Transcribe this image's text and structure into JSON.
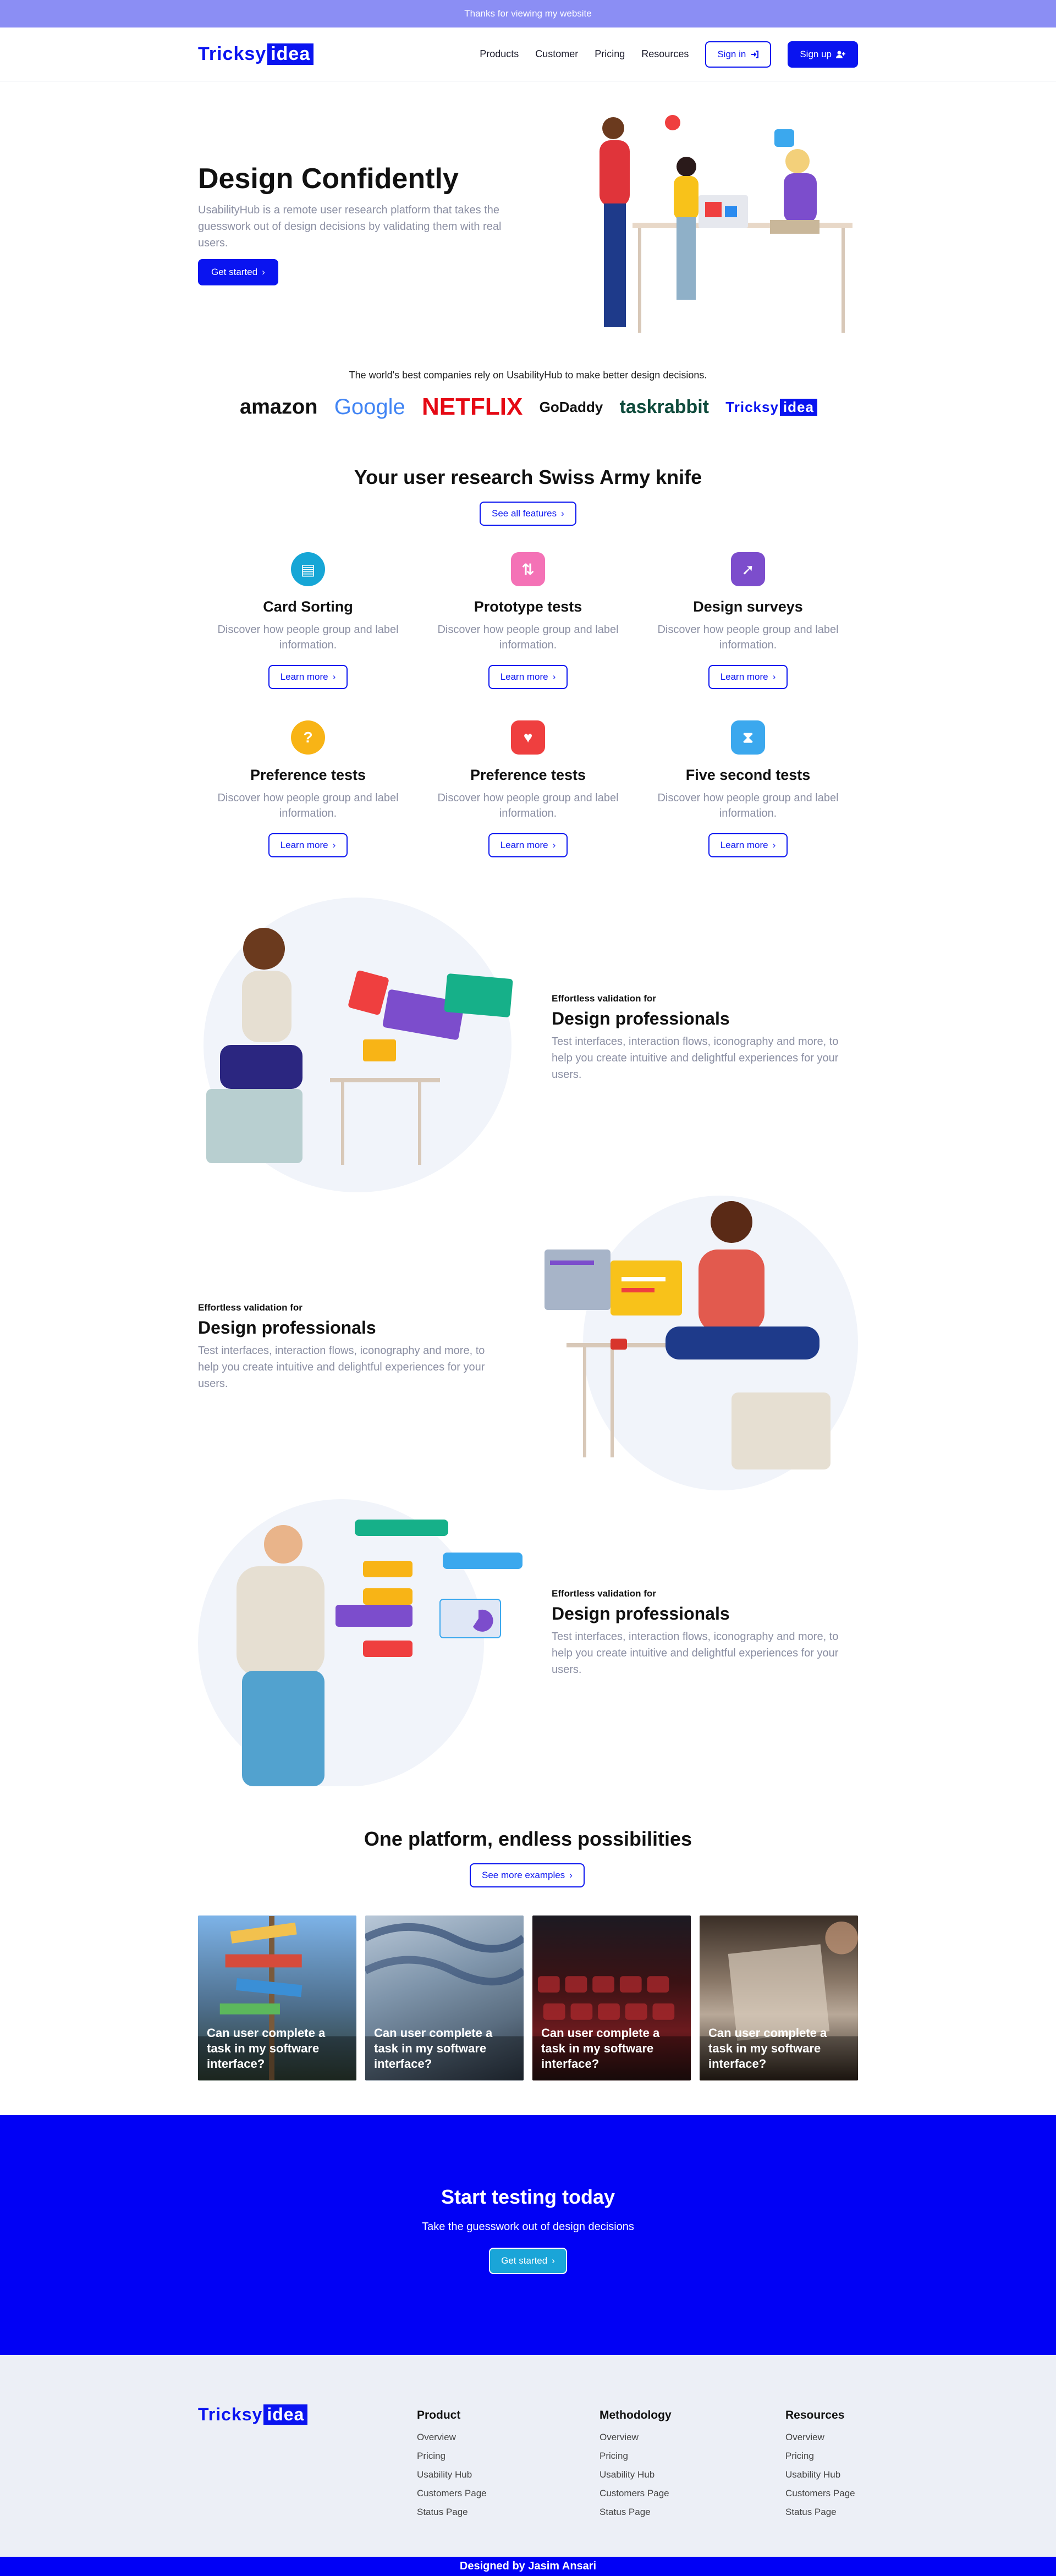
{
  "banner": {
    "text": "Thanks for viewing my website"
  },
  "brand": {
    "name_part1": "Tricksy",
    "name_part2": "idea"
  },
  "nav": {
    "links": [
      "Products",
      "Customer",
      "Pricing",
      "Resources"
    ],
    "sign_in": "Sign in",
    "sign_up": "Sign up"
  },
  "hero": {
    "title": "Design Confidently",
    "description": "UsabilityHub is a remote user research platform that takes the guesswork out of design decisions by validating them with real users.",
    "cta": "Get started"
  },
  "trusted": {
    "text": "The world's best companies rely on UsabilityHub to make better design decisions.",
    "brands": [
      "amazon",
      "Google",
      "NETFLIX",
      "GoDaddy",
      "taskrabbit",
      "Tricksy",
      "idea"
    ]
  },
  "features": {
    "title": "Your user research Swiss Army knife",
    "see_all": "See all features",
    "items": [
      {
        "title": "Card Sorting",
        "desc": "Discover how people group and label information.",
        "btn": "Learn more"
      },
      {
        "title": "Prototype tests",
        "desc": "Discover how people group and label information.",
        "btn": "Learn more"
      },
      {
        "title": "Design surveys",
        "desc": "Discover how people group and label information.",
        "btn": "Learn more"
      },
      {
        "title": "Preference tests",
        "desc": "Discover how people group and label information.",
        "btn": "Learn more"
      },
      {
        "title": "Preference tests",
        "desc": "Discover how people group and label information.",
        "btn": "Learn more"
      },
      {
        "title": "Five second tests",
        "desc": "Discover how people group and label information.",
        "btn": "Learn more"
      }
    ],
    "colors": [
      "#16a6d6",
      "#f472b6",
      "#7c4dcc",
      "#f8b416",
      "#ef3f3f",
      "#3ba8ee"
    ]
  },
  "validation": [
    {
      "small": "Effortless validation for",
      "title": "Design professionals",
      "desc": "Test interfaces, interaction flows, iconography and more, to help you create intuitive and delightful experiences for your users."
    },
    {
      "small": "Effortless validation for",
      "title": "Design professionals",
      "desc": "Test interfaces, interaction flows, iconography and more, to help you create intuitive and delightful experiences for your users."
    },
    {
      "small": "Effortless validation for",
      "title": "Design professionals",
      "desc": "Test interfaces, interaction flows, iconography and more, to help you create intuitive and delightful experiences for your users."
    }
  ],
  "platform": {
    "title": "One platform, endless possibilities",
    "see_more": "See more examples",
    "cards": [
      {
        "text": "Can user complete a task in my software interface?"
      },
      {
        "text": "Can user complete a task in my software interface?"
      },
      {
        "text": "Can user complete a task in my software interface?"
      },
      {
        "text": "Can user complete a task in my software interface?"
      }
    ]
  },
  "cta": {
    "title": "Start testing today",
    "subtitle": "Take the guesswork out of design decisions",
    "button": "Get started"
  },
  "footer": {
    "columns": [
      {
        "title": "Product",
        "links": [
          "Overview",
          "Pricing",
          "Usability Hub",
          "Customers Page",
          "Status Page"
        ]
      },
      {
        "title": "Methodology",
        "links": [
          "Overview",
          "Pricing",
          "Usability Hub",
          "Customers Page",
          "Status Page"
        ]
      },
      {
        "title": "Resources",
        "links": [
          "Overview",
          "Pricing",
          "Usability Hub",
          "Customers Page",
          "Status Page"
        ]
      }
    ],
    "credit": "Designed by Jasim Ansari"
  }
}
